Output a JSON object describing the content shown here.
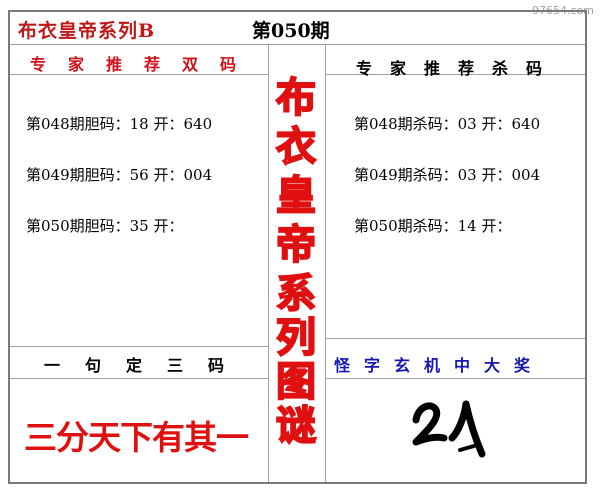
{
  "header": {
    "title": "布衣皇帝系列B",
    "issue": "第050期",
    "watermark": "97654.com"
  },
  "left_panel": {
    "heading": "专家推荐双码",
    "rows": [
      "第048期胆码：18 开：640",
      "第049期胆码：56 开：004",
      "第050期胆码：35 开："
    ]
  },
  "right_panel": {
    "heading": "专家推荐杀码",
    "rows": [
      "第048期杀码：03 开：640",
      "第049期杀码：03 开：004",
      "第050期杀码：14 开："
    ]
  },
  "center_vertical": {
    "chars": [
      "布",
      "衣",
      "皇",
      "帝",
      "系",
      "列",
      "图",
      "谜"
    ]
  },
  "bottom_left": {
    "heading": "一句定三码",
    "phrase": "三分天下有其一"
  },
  "bottom_right": {
    "heading": "怪字玄机中大奖",
    "handwriting": "21"
  },
  "colors": {
    "red": "#d4101a",
    "blue": "#1616b0",
    "border": "#7a7a7a"
  }
}
